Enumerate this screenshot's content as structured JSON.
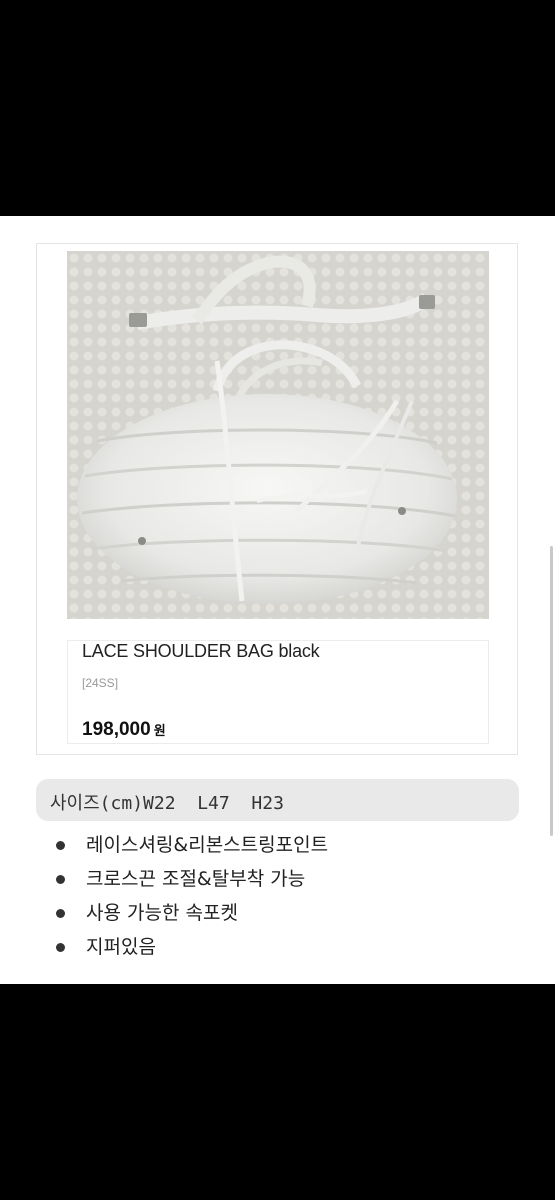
{
  "product": {
    "name": "LACE SHOULDER BAG black",
    "season": "[24SS]",
    "price": "198,000",
    "currency": "원",
    "image_label": "white shirred lace shoulder bag photo"
  },
  "size_info": "사이즈(cm)W22  L47  H23",
  "features": [
    "레이스셔링&리본스트링포인트",
    "크로스끈 조절&탈부착 가능",
    "사용 가능한 속포켓",
    "지퍼있음"
  ]
}
